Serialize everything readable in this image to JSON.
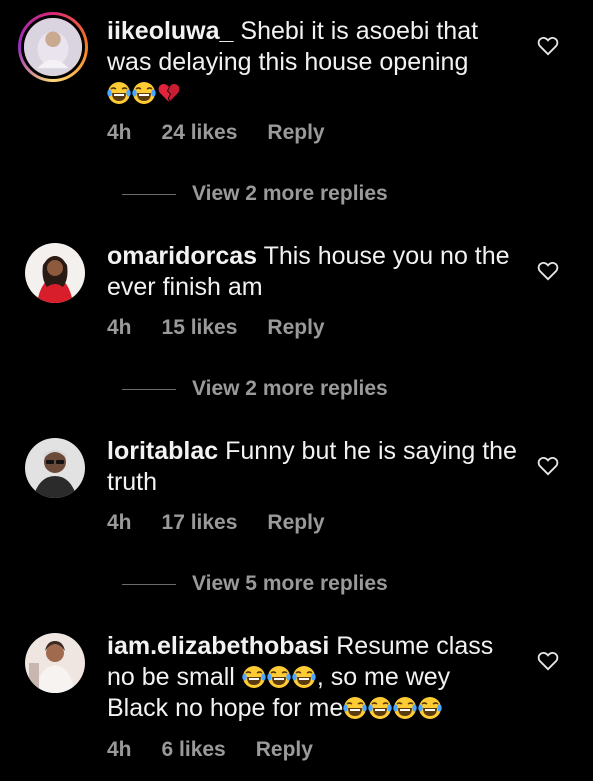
{
  "comments": [
    {
      "username": "iikeoluwa_",
      "text": "Shebi it is asoebi that was delaying this house opening",
      "time": "4h",
      "likes": "24 likes",
      "reply": "Reply",
      "view_more": "View 2 more replies",
      "emojis": [
        "face-with-tears-of-joy-icon",
        "face-with-tears-of-joy-icon",
        "broken-heart-icon"
      ]
    },
    {
      "username": "omaridorcas",
      "text": "This house you no the ever finish am",
      "time": "4h",
      "likes": "15 likes",
      "reply": "Reply",
      "view_more": "View 2 more replies"
    },
    {
      "username": "loritablac",
      "text": "Funny but he is saying the truth",
      "time": "4h",
      "likes": "17 likes",
      "reply": "Reply",
      "view_more": "View 5 more replies"
    },
    {
      "username": "iam.elizabethobasi",
      "text_part1": "Resume class no be small",
      "text_part2": ", so me wey Black no hope for me",
      "time": "4h",
      "likes": "6 likes",
      "reply": "Reply"
    }
  ],
  "colors": {
    "background": "#000000",
    "text": "#f2f2f2",
    "secondary": "#9a9a9a",
    "story_ring": "#d62976"
  }
}
